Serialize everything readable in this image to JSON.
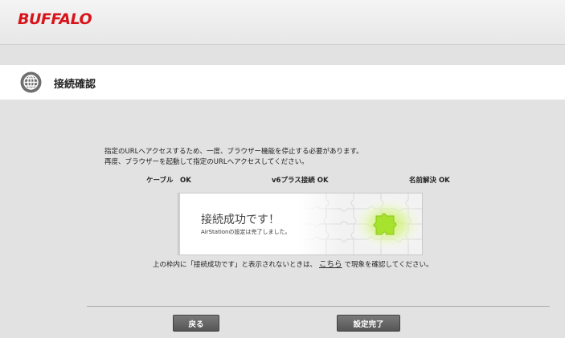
{
  "header": {
    "logo": "BUFFALO"
  },
  "page": {
    "title": "接続確認"
  },
  "message": {
    "line1": "指定のURLへアクセスするため、一度、ブラウザー機能を停止する必要があります。",
    "line2": "再度、ブラウザーを起動して指定のURLへアクセスしてください。"
  },
  "status": {
    "cable": "ケーブル　OK",
    "v6plus": "v6プラス接続 OK",
    "dns": "名前解決 OK"
  },
  "frame": {
    "title": "接続成功です！",
    "subtitle": "AirStationの設定は完了しました。"
  },
  "hint": {
    "before": "上の枠内に「接続成功です」と表示されないときは、",
    "link": "こちら",
    "after": "で現象を確認してください。"
  },
  "buttons": {
    "back": "戻る",
    "finish": "設定完了"
  },
  "colors": {
    "brand": "#d8141b",
    "button": "#5e5e5e",
    "puzzle_glow": "#a6e22e"
  }
}
